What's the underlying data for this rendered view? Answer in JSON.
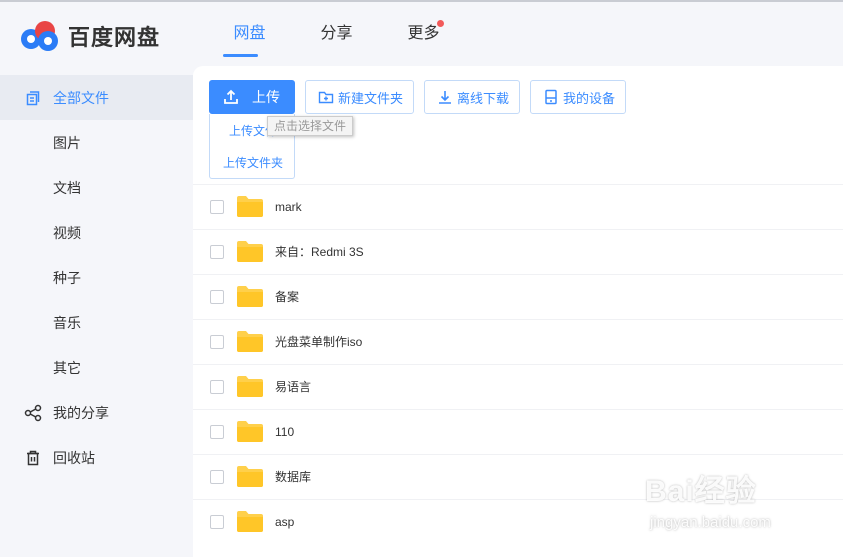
{
  "app": {
    "logo_text": "百度网盘"
  },
  "nav": {
    "items": [
      {
        "label": "网盘",
        "active": true
      },
      {
        "label": "分享"
      },
      {
        "label": "更多",
        "has_dot": true
      }
    ]
  },
  "sidebar": {
    "items": [
      {
        "label": "全部文件",
        "icon": "files-icon",
        "active": true
      },
      {
        "label": "图片"
      },
      {
        "label": "文档"
      },
      {
        "label": "视频"
      },
      {
        "label": "种子"
      },
      {
        "label": "音乐"
      },
      {
        "label": "其它"
      },
      {
        "label": "我的分享",
        "icon": "share-icon"
      },
      {
        "label": "回收站",
        "icon": "trash-icon"
      }
    ]
  },
  "toolbar": {
    "upload": "上传",
    "new_folder": "新建文件夹",
    "offline_download": "离线下载",
    "my_devices": "我的设备"
  },
  "upload_menu": {
    "upload_file": "上传文件",
    "upload_folder": "上传文件夹",
    "tooltip": "点击选择文件"
  },
  "files": [
    {
      "name": "mark"
    },
    {
      "name": "来自：Redmi 3S"
    },
    {
      "name": "备案"
    },
    {
      "name": "光盘菜单制作iso"
    },
    {
      "name": "易语言"
    },
    {
      "name": "110"
    },
    {
      "name": "数据库"
    },
    {
      "name": "asp"
    }
  ],
  "watermark": {
    "logo": "Bai经验",
    "url": "jingyan.baidu.com"
  },
  "colors": {
    "accent": "#3b8cff",
    "folder": "#ffd04b",
    "badge": "#f25a5a"
  }
}
